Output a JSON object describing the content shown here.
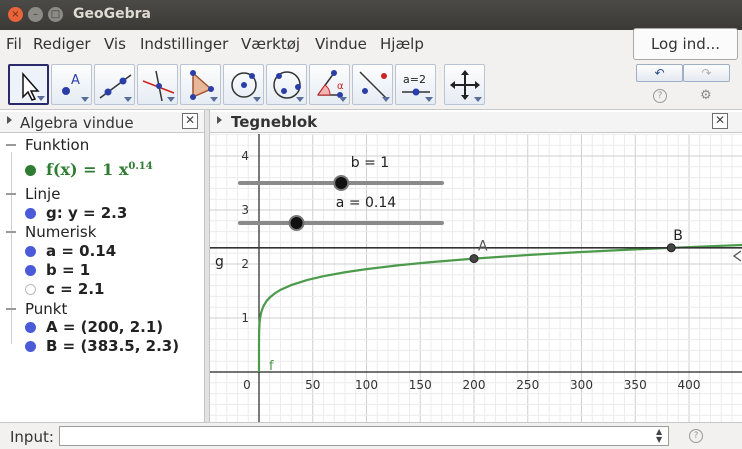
{
  "window": {
    "title": "GeoGebra",
    "close_glyph": "×",
    "min_glyph": "–",
    "max_glyph": "□"
  },
  "menu": {
    "items": [
      "Fil",
      "Rediger",
      "Vis",
      "Indstillinger",
      "Værktøj",
      "Vindue",
      "Hjælp"
    ],
    "login_label": "Log ind..."
  },
  "toolbar": {
    "tools": [
      "move-tool",
      "point-tool",
      "line-tool",
      "perpendicular-line-tool",
      "polygon-tool",
      "circle-center-tool",
      "circle-three-points-tool",
      "angle-tool",
      "reflect-tool",
      "slider-tool",
      "move-graphics-tool"
    ],
    "slider_tool_label": "a=2",
    "undo_glyph": "↶",
    "redo_glyph": "↷",
    "help_glyph": "?",
    "settings_glyph": "⚙"
  },
  "algebra": {
    "title": "Algebra vindue",
    "close_glyph": "✕",
    "categories": [
      {
        "label": "Funktion",
        "items": [
          {
            "text": "f(x)  =  1 x",
            "sup": "0.14",
            "color": "#2e7d32"
          }
        ]
      },
      {
        "label": "Linje",
        "items": [
          {
            "text": "g: y = 2.3",
            "color": "#222222"
          }
        ]
      },
      {
        "label": "Numerisk",
        "items": [
          {
            "text": "a = 0.14",
            "color": "#222222"
          },
          {
            "text": "b = 1",
            "color": "#222222"
          },
          {
            "text": "c = 2.1",
            "color": "#222222"
          }
        ]
      },
      {
        "label": "Punkt",
        "items": [
          {
            "text": "A = (200, 2.1)",
            "color": "#222222"
          },
          {
            "text": "B = (383.5, 2.3)",
            "color": "#222222"
          }
        ]
      }
    ]
  },
  "graphics": {
    "title": "Tegneblok",
    "close_glyph": "✕",
    "x_ticks": [
      "0",
      "50",
      "100",
      "150",
      "200",
      "250",
      "300",
      "350",
      "400"
    ],
    "y_ticks": [
      "1",
      "2",
      "3",
      "4"
    ],
    "slider_b_label": "b = 1",
    "slider_a_label": "a = 0.14",
    "slider_b_value": 1,
    "slider_a_value": 0.14,
    "line_label": "g",
    "curve_label": "f",
    "point_a_label": "A",
    "point_b_label": "B",
    "curve_color": "#4c9a4c",
    "line_color": "#333333"
  },
  "input": {
    "label": "Input:",
    "value": "",
    "help_glyph": "?"
  }
}
